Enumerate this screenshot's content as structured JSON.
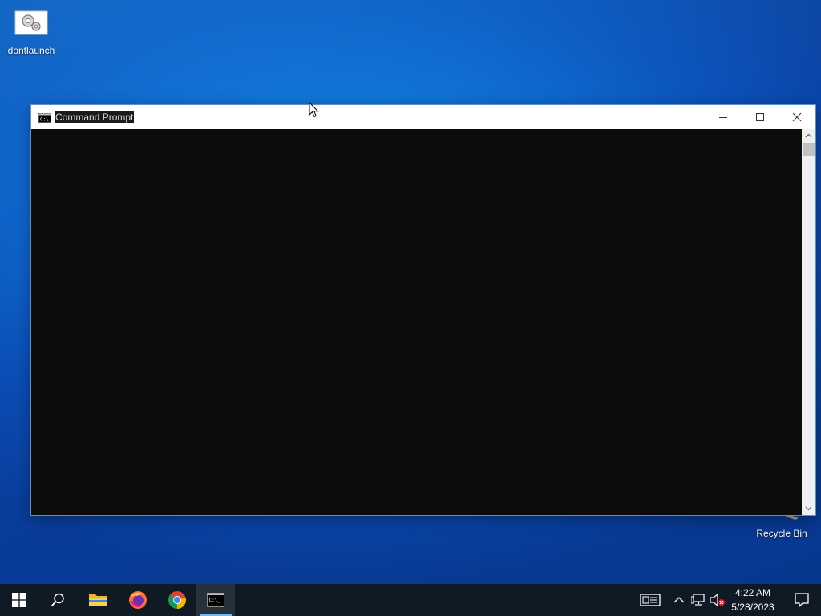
{
  "desktop": {
    "icons": [
      {
        "label": "dontlaunch",
        "icon": "settings-gears-icon"
      },
      {
        "label": "Recycle Bin",
        "icon": "recycle-bin-icon"
      }
    ]
  },
  "window": {
    "title": "Command Prompt",
    "icon": "cmd-app-icon",
    "controls": {
      "minimize": "minimize-icon",
      "maximize": "maximize-icon",
      "close": "close-icon"
    },
    "console_background": "#0c0c0c"
  },
  "taskbar": {
    "start": "windows-logo-icon",
    "search": "search-icon",
    "pinned": [
      {
        "app": "File Explorer",
        "icon": "folder-icon"
      },
      {
        "app": "Firefox",
        "icon": "firefox-icon"
      },
      {
        "app": "Chrome",
        "icon": "chrome-icon"
      },
      {
        "app": "Command Prompt",
        "icon": "cmd-icon",
        "active": true
      }
    ],
    "tray": {
      "icons": [
        "news-icon",
        "chevron-up-icon",
        "network-icon",
        "volume-muted-icon",
        "notifications-icon"
      ],
      "time": "4:22 AM",
      "date": "5/28/2023"
    }
  },
  "colors": {
    "desktop_blue": "#0d6fd2",
    "taskbar": "#101a24",
    "active_underline": "#76b9ed"
  }
}
